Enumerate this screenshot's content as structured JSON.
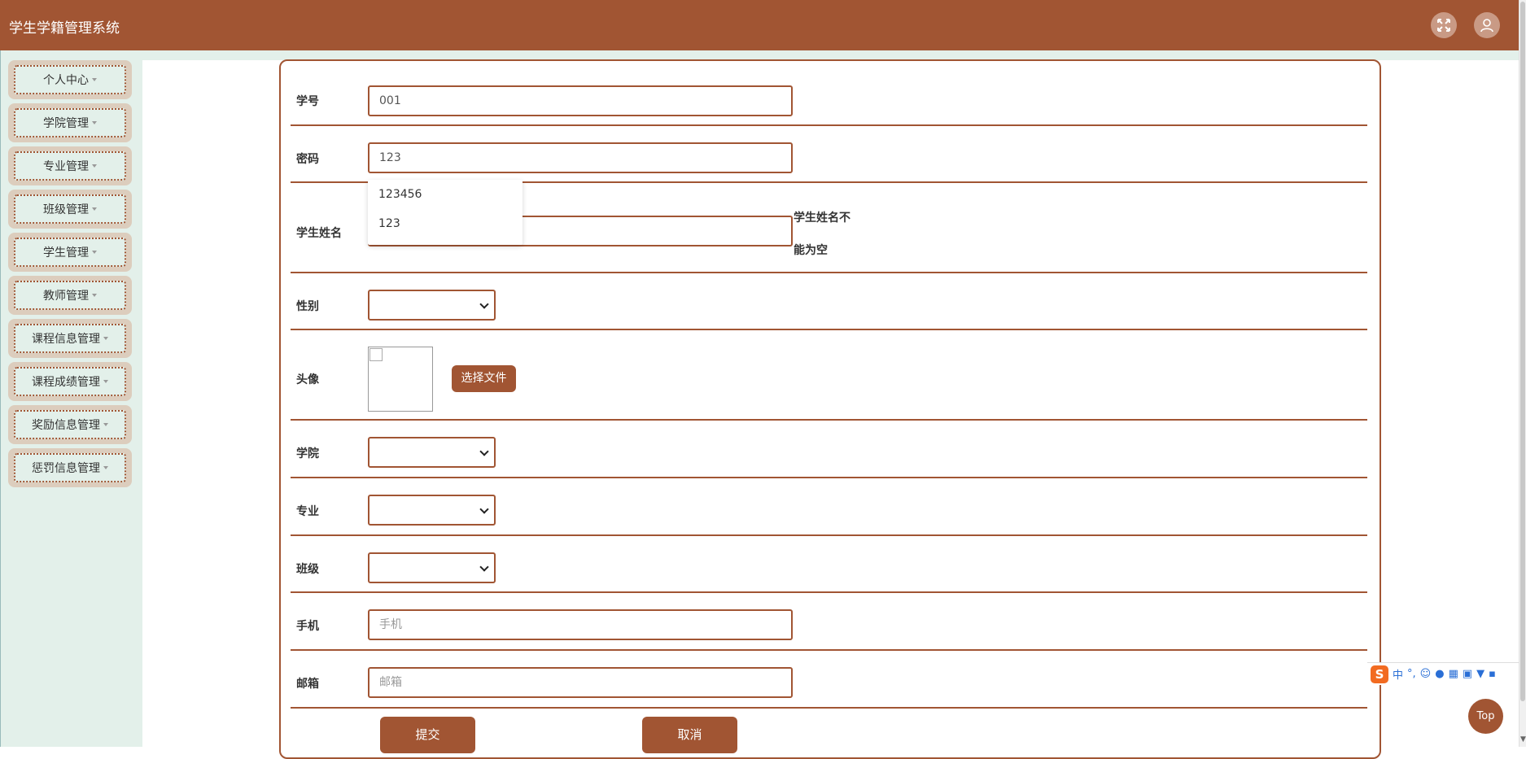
{
  "header": {
    "title": "学生学籍管理系统",
    "fullscreen_icon": "fullscreen-icon",
    "user_icon": "user-icon"
  },
  "sidebar": {
    "items": [
      {
        "label": "个人中心"
      },
      {
        "label": "学院管理"
      },
      {
        "label": "专业管理"
      },
      {
        "label": "班级管理"
      },
      {
        "label": "学生管理"
      },
      {
        "label": "教师管理"
      },
      {
        "label": "课程信息管理"
      },
      {
        "label": "课程成绩管理"
      },
      {
        "label": "奖励信息管理"
      },
      {
        "label": "惩罚信息管理"
      }
    ]
  },
  "form": {
    "student_id": {
      "label": "学号",
      "value": "001"
    },
    "password": {
      "label": "密码",
      "value": "123"
    },
    "autocomplete": {
      "options": [
        "123456",
        "123"
      ]
    },
    "student_name": {
      "label": "学生姓名",
      "value": "",
      "error_line1": "学生姓名不",
      "error_line2": "能为空"
    },
    "gender": {
      "label": "性别",
      "value": ""
    },
    "avatar": {
      "label": "头像",
      "file_button": "选择文件"
    },
    "college": {
      "label": "学院",
      "value": ""
    },
    "major": {
      "label": "专业",
      "value": ""
    },
    "class": {
      "label": "班级",
      "value": ""
    },
    "phone": {
      "label": "手机",
      "placeholder": "手机"
    },
    "email": {
      "label": "邮箱",
      "placeholder": "邮箱"
    },
    "submit_label": "提交",
    "cancel_label": "取消"
  },
  "ime": {
    "mode": "中",
    "punct": "°,"
  },
  "top_button": "Top",
  "colors": {
    "brand": "#a15533",
    "sidebar_bg": "#e3f0ea",
    "sidebar_item_bg": "#dccdbd"
  }
}
